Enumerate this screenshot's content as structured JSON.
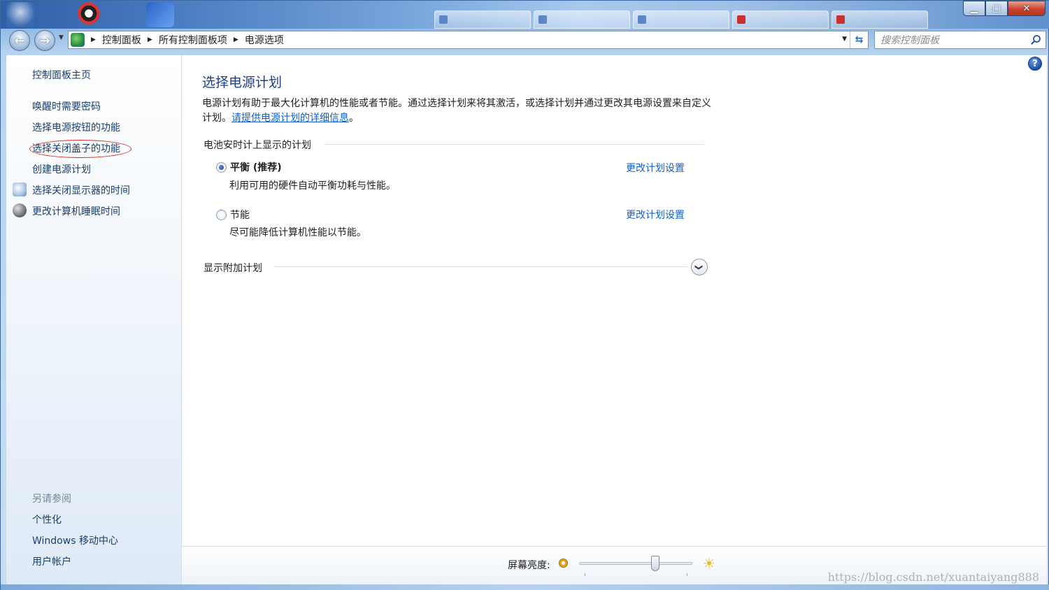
{
  "window": {
    "controls": {
      "minimize": "▁",
      "maximize": "□",
      "close": "✕"
    },
    "background_tabs": [
      "",
      "",
      "",
      "",
      "",
      ""
    ]
  },
  "nav": {
    "back_icon": "←",
    "forward_icon": "→",
    "dropdown": "▼",
    "breadcrumbs": [
      "控制面板",
      "所有控制面板项",
      "电源选项"
    ],
    "breadcrumb_sep": "▶",
    "address_dropdown": "▼",
    "refresh_icon": "⇆"
  },
  "search": {
    "placeholder": "搜索控制面板"
  },
  "sidebar": {
    "home": "控制面板主页",
    "links": [
      "唤醒时需要密码",
      "选择电源按钮的功能",
      "选择关闭盖子的功能",
      "创建电源计划",
      "选择关闭显示器的时间",
      "更改计算机睡眠时间"
    ],
    "see_also_title": "另请参阅",
    "see_also": [
      "个性化",
      "Windows 移动中心",
      "用户帐户"
    ]
  },
  "main": {
    "help_icon": "?",
    "title": "选择电源计划",
    "description_1": "电源计划有助于最大化计算机的性能或者节能。通过选择计划来将其激活，或选择计划并通过更改其电源设置来自定义计划。",
    "description_link": "请提供电源计划的详细信息",
    "description_end": "。",
    "group_title": "电池安时计上显示的计划",
    "plans": [
      {
        "name": "平衡 (推荐)",
        "desc": "利用可用的硬件自动平衡功耗与性能。",
        "link": "更改计划设置",
        "selected": true
      },
      {
        "name": "节能",
        "desc": "尽可能降低计算机性能以节能。",
        "link": "更改计划设置",
        "selected": false
      }
    ],
    "additional_plans": "显示附加计划",
    "expand_icon": "❯"
  },
  "bottom": {
    "brightness_label": "屏幕亮度:",
    "brightness_value": 0.67,
    "bright_icon": "☀",
    "watermark": "https://blog.csdn.net/xuantaiyang888"
  }
}
